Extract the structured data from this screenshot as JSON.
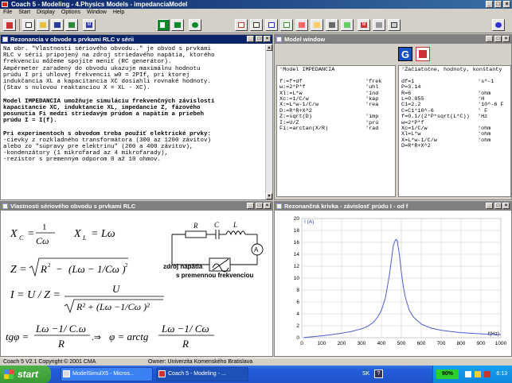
{
  "app": {
    "title": "Coach 5 - Modeling - 4.Physics Models - impedanciaModel"
  },
  "menu": [
    "File",
    "Start",
    "Display",
    "Options",
    "Window",
    "Help"
  ],
  "toolbar": {
    "m_label": "M",
    "m2_label": "M"
  },
  "text_window": {
    "title": "Rezonancia v obvode s prvkami RLC v sérii",
    "lines": [
      "Na obr. \"Vlastnosti sériového obvodu..\" je obvod s prvkami",
      "RLC v sérii pripojený na zdroj striedavého napätia, ktorého",
      "frekvenciu môžeme spojite meniť (RC generátor).",
      "Ampérmeter zaradený do obvodu ukazuje maximálnu hodnotu",
      "prúdu I pri uhlovej frekvencii w0 = 2PIf, pri ktorej",
      "indukčancia XL a kapacitancia XC dosiahli rovnaké hodnoty.",
      "(Stav s nulovou reaktanciou X = XL - XC).",
      "",
      "Model IMPEDANCIA umožňuje simuláciu frekvenčných závislostí",
      "kapacitancie XC, induktancie XL, impedancie Z, fázového",
      "posunutia Fi medzi striedavým prúdom a napätím a priebeh",
      "prúdu I = I(f).",
      "",
      "Pri experimentoch s obvodom treba použiť elektrické prvky:",
      "-cievky z rozkladného transformátora (300 az 1200 závitov)",
      "alebo zo \"súpravy pre elektrinu\" (200 a 400 závitov),",
      "-kondenzátory (1 mikrofarad az 4 mikrofarady),",
      "-rezistor s premenným odporom 0 až 10 ohmov."
    ]
  },
  "model_window": {
    "title": "Model window",
    "g_label": "G",
    "left_header": "'Model IMPEDANCIA",
    "left_lines": [
      [
        "f:=f+df",
        "'frek"
      ],
      [
        "w:=2*P*f",
        "'uhl"
      ],
      [
        "Xl:=L*w",
        "'ind"
      ],
      [
        "Xc:=1/C/w",
        "'kap"
      ],
      [
        "X:=L*w-1/C/w",
        "'rea"
      ],
      [
        "D:=R*R+X^2",
        ""
      ],
      [
        "Z:=sqrt(D)",
        "'imp"
      ],
      [
        "I:=U/Z",
        "'prú"
      ],
      [
        "Fi:=arctan(X/R)",
        "'rad"
      ]
    ],
    "right_header": "'Začiatočne, hodnoty, konštanty",
    "right_lines": [
      [
        "df=1",
        "'s^-1"
      ],
      [
        "P=3.14",
        ""
      ],
      [
        "R=6",
        "'ohm"
      ],
      [
        "L=0.055",
        "'H"
      ],
      [
        "C1=2.2",
        "'10^-6 F"
      ],
      [
        "C=C1*10^-6",
        "' F"
      ],
      [
        "f=0.1/(2*P*sqrt(L*C))",
        "'Hz"
      ],
      [
        "w=2*P*f",
        ""
      ],
      [
        "Xc=1/C/w",
        "'ohm"
      ],
      [
        "Xl=L*w",
        "'ohm"
      ],
      [
        "X=L*w-1/C/w",
        "'ohm"
      ],
      [
        "D=R*R+X^2",
        ""
      ]
    ]
  },
  "formula_window": {
    "title": "Vlastnosti sériového obvodu s prvkami RLC",
    "label_r": "R",
    "label_c": "C",
    "label_l": "L",
    "label_a": "A",
    "source_line1": "zdroj napätia",
    "source_line2": "s premennou frekvenciou"
  },
  "graph_window": {
    "title": "Rezonančná krivka - závislosť prúdu I - od f"
  },
  "chart_data": {
    "type": "line",
    "title": "",
    "ylabel": "I (A)",
    "xlabel": "f(Hz)",
    "xlim": [
      0,
      1000
    ],
    "ylim": [
      0,
      20
    ],
    "xticks": [
      0,
      100,
      200,
      300,
      400,
      500,
      600,
      700,
      800,
      900,
      1000
    ],
    "yticks": [
      0,
      2,
      4,
      6,
      8,
      10,
      12,
      14,
      16,
      18,
      20
    ],
    "color": "#4a5fd0",
    "series": [
      {
        "x": [
          10,
          50,
          100,
          150,
          200,
          250,
          300,
          330,
          360,
          380,
          400,
          420,
          440,
          450,
          460,
          470,
          475,
          480,
          490,
          500,
          510,
          520,
          540,
          560,
          600,
          650,
          700,
          750,
          800,
          850,
          900,
          950,
          1000
        ],
        "y": [
          0.03,
          0.15,
          0.32,
          0.52,
          0.75,
          1.05,
          1.5,
          1.9,
          2.6,
          3.4,
          4.6,
          6.7,
          10.5,
          13.0,
          15.5,
          16.4,
          16.5,
          16.2,
          14.0,
          11.0,
          8.6,
          6.8,
          4.6,
          3.5,
          2.3,
          1.6,
          1.25,
          1.02,
          0.86,
          0.74,
          0.65,
          0.58,
          0.52
        ]
      }
    ]
  },
  "status": {
    "left": "Coach 5 V2.1 Copyright © 2001 CMA",
    "right": "Owner: Univerzita Komenského Bratislava"
  },
  "taskbar": {
    "start": "start",
    "tasks": [
      "ModelSimulX5 - Micros...",
      "Coach 5 - Modeling - ..."
    ],
    "lang": "SK",
    "battery": "90%",
    "time": "6:13"
  }
}
